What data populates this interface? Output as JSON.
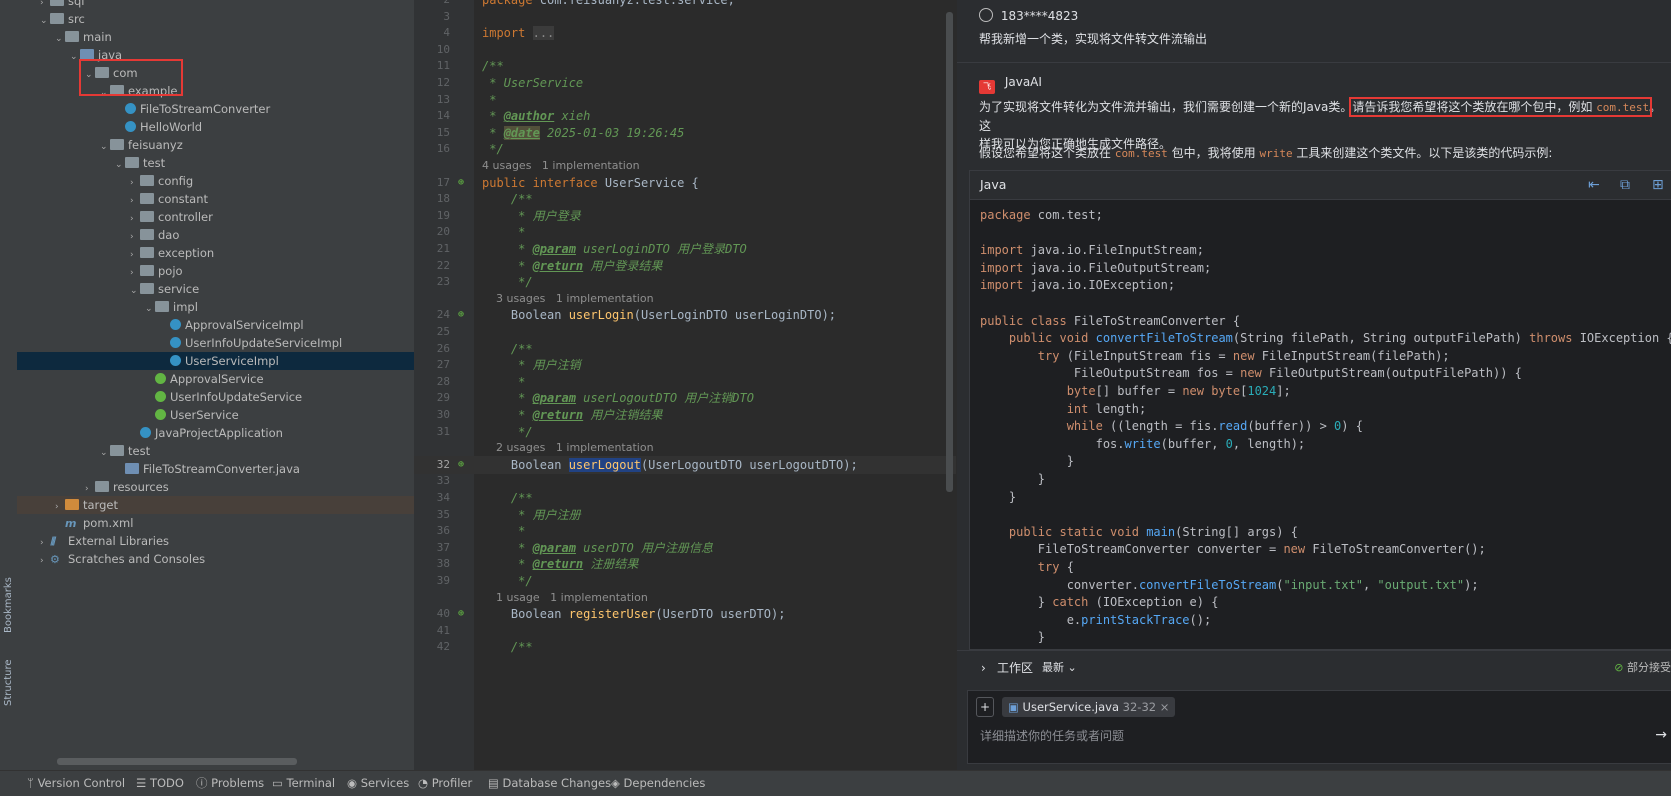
{
  "side_tabs": {
    "bookmarks": "Bookmarks",
    "structure": "Structure"
  },
  "project_tree": [
    {
      "label": "sql",
      "depth": 1,
      "type": "folder",
      "expanded": false
    },
    {
      "label": "src",
      "depth": 1,
      "type": "folder",
      "expanded": true
    },
    {
      "label": "main",
      "depth": 2,
      "type": "folder",
      "expanded": true
    },
    {
      "label": "java",
      "depth": 3,
      "type": "folder-blue",
      "expanded": true
    },
    {
      "label": "com",
      "depth": 4,
      "type": "package",
      "expanded": true
    },
    {
      "label": "example",
      "depth": 5,
      "type": "package",
      "expanded": true
    },
    {
      "label": "FileToStreamConverter",
      "depth": 6,
      "type": "class"
    },
    {
      "label": "HelloWorld",
      "depth": 6,
      "type": "class"
    },
    {
      "label": "feisuanyz",
      "depth": 5,
      "type": "package",
      "expanded": true
    },
    {
      "label": "test",
      "depth": 6,
      "type": "package",
      "expanded": true
    },
    {
      "label": "config",
      "depth": 7,
      "type": "package",
      "expanded": false
    },
    {
      "label": "constant",
      "depth": 7,
      "type": "package",
      "expanded": false
    },
    {
      "label": "controller",
      "depth": 7,
      "type": "package",
      "expanded": false
    },
    {
      "label": "dao",
      "depth": 7,
      "type": "package",
      "expanded": false
    },
    {
      "label": "exception",
      "depth": 7,
      "type": "package",
      "expanded": false
    },
    {
      "label": "pojo",
      "depth": 7,
      "type": "package",
      "expanded": false
    },
    {
      "label": "service",
      "depth": 7,
      "type": "package",
      "expanded": true
    },
    {
      "label": "impl",
      "depth": 8,
      "type": "package",
      "expanded": true
    },
    {
      "label": "ApprovalServiceImpl",
      "depth": 9,
      "type": "class"
    },
    {
      "label": "UserInfoUpdateServiceImpl",
      "depth": 9,
      "type": "class"
    },
    {
      "label": "UserServiceImpl",
      "depth": 9,
      "type": "class",
      "selected": true
    },
    {
      "label": "ApprovalService",
      "depth": 8,
      "type": "interface"
    },
    {
      "label": "UserInfoUpdateService",
      "depth": 8,
      "type": "interface"
    },
    {
      "label": "UserService",
      "depth": 8,
      "type": "interface"
    },
    {
      "label": "JavaProjectApplication",
      "depth": 7,
      "type": "class"
    },
    {
      "label": "test",
      "depth": 5,
      "type": "package",
      "expanded": true
    },
    {
      "label": "FileToStreamConverter.java",
      "depth": 6,
      "type": "javafile"
    },
    {
      "label": "resources",
      "depth": 4,
      "type": "folder",
      "expanded": false
    },
    {
      "label": "target",
      "depth": 2,
      "type": "folder-orange",
      "expanded": false,
      "highlight": true
    },
    {
      "label": "pom.xml",
      "depth": 2,
      "type": "maven"
    },
    {
      "label": "External Libraries",
      "depth": 1,
      "type": "libs",
      "expanded": false
    },
    {
      "label": "Scratches and Consoles",
      "depth": 1,
      "type": "scratch",
      "expanded": false
    }
  ],
  "editor": {
    "lines": [
      {
        "n": "2",
        "html": "<span class='kw'>package</span> com.feisuanyz.test.service;"
      },
      {
        "n": "3",
        "html": ""
      },
      {
        "n": "4",
        "html": "<span class='kw'>import</span> <span style='background:#3b3b3b;color:#888'>...</span>"
      },
      {
        "n": "10",
        "html": ""
      },
      {
        "n": "11",
        "html": "<span class='cmt'>/**</span>"
      },
      {
        "n": "12",
        "html": "<span class='cmt'> * UserService</span>"
      },
      {
        "n": "13",
        "html": "<span class='cmt'> *</span>"
      },
      {
        "n": "14",
        "html": "<span class='cmt'> * </span><span class='tag'>@author</span><span class='cmt'> xieh</span>"
      },
      {
        "n": "15",
        "html": "<span class='cmt'> * </span><span class='tag' style='background:#52503a'>@date</span><span class='cmt'> 2025-01-03 19:26:45</span>"
      },
      {
        "n": "16",
        "html": "<span class='cmt'> */</span>"
      },
      {
        "hint": "4 usages   1 implementation"
      },
      {
        "n": "17",
        "html": "<span class='kw'>public interface</span> UserService {",
        "gutter": "impl"
      },
      {
        "n": "18",
        "html": "    <span class='cmt'>/**</span>"
      },
      {
        "n": "19",
        "html": "<span class='cmt'>     * 用户登录</span>"
      },
      {
        "n": "20",
        "html": "<span class='cmt'>     *</span>"
      },
      {
        "n": "21",
        "html": "<span class='cmt'>     * </span><span class='tag'>@param</span><span class='cmt'> userLoginDTO 用户登录DTO</span>"
      },
      {
        "n": "22",
        "html": "<span class='cmt'>     * </span><span class='tag'>@return</span><span class='cmt'> 用户登录结果</span>"
      },
      {
        "n": "23",
        "html": "<span class='cmt'>     */</span>"
      },
      {
        "hint": "    3 usages   1 implementation"
      },
      {
        "n": "24",
        "html": "    Boolean <span class='m'>userLogin</span>(UserLoginDTO userLoginDTO);",
        "gutter": "impl"
      },
      {
        "n": "25",
        "html": ""
      },
      {
        "n": "26",
        "html": "    <span class='cmt'>/**</span>"
      },
      {
        "n": "27",
        "html": "<span class='cmt'>     * 用户注销</span>"
      },
      {
        "n": "28",
        "html": "<span class='cmt'>     *</span>"
      },
      {
        "n": "29",
        "html": "<span class='cmt'>     * </span><span class='tag'>@param</span><span class='cmt'> userLogoutDTO 用户注销DTO</span>"
      },
      {
        "n": "30",
        "html": "<span class='cmt'>     * </span><span class='tag'>@return</span><span class='cmt'> 用户注销结果</span>"
      },
      {
        "n": "31",
        "html": "<span class='cmt'>     */</span>"
      },
      {
        "hint": "    2 usages   1 implementation"
      },
      {
        "n": "32",
        "html": "    Boolean <span class='m sel-word'>userLogout</span>(UserLogoutDTO userLogoutDTO);",
        "gutter": "impl",
        "current": true
      },
      {
        "n": "33",
        "html": ""
      },
      {
        "n": "34",
        "html": "    <span class='cmt'>/**</span>"
      },
      {
        "n": "35",
        "html": "<span class='cmt'>     * 用户注册</span>"
      },
      {
        "n": "36",
        "html": "<span class='cmt'>     *</span>"
      },
      {
        "n": "37",
        "html": "<span class='cmt'>     * </span><span class='tag'>@param</span><span class='cmt'> userDTO 用户注册信息</span>"
      },
      {
        "n": "38",
        "html": "<span class='cmt'>     * </span><span class='tag'>@return</span><span class='cmt'> 注册结果</span>"
      },
      {
        "n": "39",
        "html": "<span class='cmt'>     */</span>"
      },
      {
        "hint": "    1 usage   1 implementation"
      },
      {
        "n": "40",
        "html": "    Boolean <span class='m'>registerUser</span>(UserDTO userDTO);",
        "gutter": "impl"
      },
      {
        "n": "41",
        "html": ""
      },
      {
        "n": "42",
        "html": "    <span class='cmt'>/**</span>"
      }
    ]
  },
  "chat": {
    "user": {
      "name": "183****4823",
      "message": "帮我新增一个类，实现将文件转文件流输出"
    },
    "ai": {
      "name": "JavaAI",
      "para1_a": "为了实现将文件转化为文件流并输出，我们需要创建一个新的Java类。",
      "para1_boxed": "请告诉我您希望将这个类放在哪个包中，例如 ",
      "para1_code": "com.test",
      "para1_b": "。这",
      "para1_c": "样我可以为您正确地生成文件路径。",
      "para2_a": "假设您希望将这个类放在 ",
      "para2_code1": "com.test",
      "para2_b": " 包中，我将使用 ",
      "para2_code2": "write",
      "para2_c": " 工具来创建这个类文件。以下是该类的代码示例:"
    },
    "code_block": {
      "language": "Java",
      "lines": [
        "<span class='ck'>package</span> com.test;",
        "",
        "<span class='ck'>import</span> java.io.FileInputStream;",
        "<span class='ck'>import</span> java.io.FileOutputStream;",
        "<span class='ck'>import</span> java.io.IOException;",
        "",
        "<span class='ck'>public class</span> FileToStreamConverter {",
        "    <span class='ck'>public void</span> <span class='cm'>convertFileToStream</span>(String filePath, String outputFilePath) <span class='ck'>throws</span> IOException {",
        "        <span class='ck'>try</span> (FileInputStream fis = <span class='ck'>new</span> FileInputStream(filePath);",
        "             FileOutputStream fos = <span class='ck'>new</span> FileOutputStream(outputFilePath)) {",
        "            <span class='ck'>byte</span>[] buffer = <span class='ck'>new byte</span>[<span class='cn'>1024</span>];",
        "            <span class='ck'>int</span> length;",
        "            <span class='ck'>while</span> ((length = fis.<span class='cm'>read</span>(buffer)) > <span class='cn'>0</span>) {",
        "                fos.<span class='cm'>write</span>(buffer, <span class='cn'>0</span>, length);",
        "            }",
        "        }",
        "    }",
        "",
        "    <span class='ck'>public static void</span> <span class='cm'>main</span>(String[] args) {",
        "        FileToStreamConverter converter = <span class='ck'>new</span> FileToStreamConverter();",
        "        <span class='ck'>try</span> {",
        "            converter.<span class='cm'>convertFileToStream</span>(<span class='cs'>\"input.txt\"</span>, <span class='cs'>\"output.txt\"</span>);",
        "        } <span class='ck'>catch</span> (IOException e) {",
        "            e.<span class='cm'>printStackTrace</span>();",
        "        }"
      ]
    },
    "workspace": {
      "label": "工作区",
      "filter": "最新",
      "accept": "部分接受"
    },
    "input": {
      "chip_file": "UserService.java",
      "chip_range": "32-32",
      "placeholder": "详细描述你的任务或者问题"
    }
  },
  "statusbar": [
    "Version Control",
    "TODO",
    "Problems",
    "Terminal",
    "Services",
    "Profiler",
    "Database Changes",
    "Dependencies"
  ],
  "colors": {
    "redbox": "#e53935",
    "selection": "#0d293e",
    "accent": "#3592c4"
  }
}
